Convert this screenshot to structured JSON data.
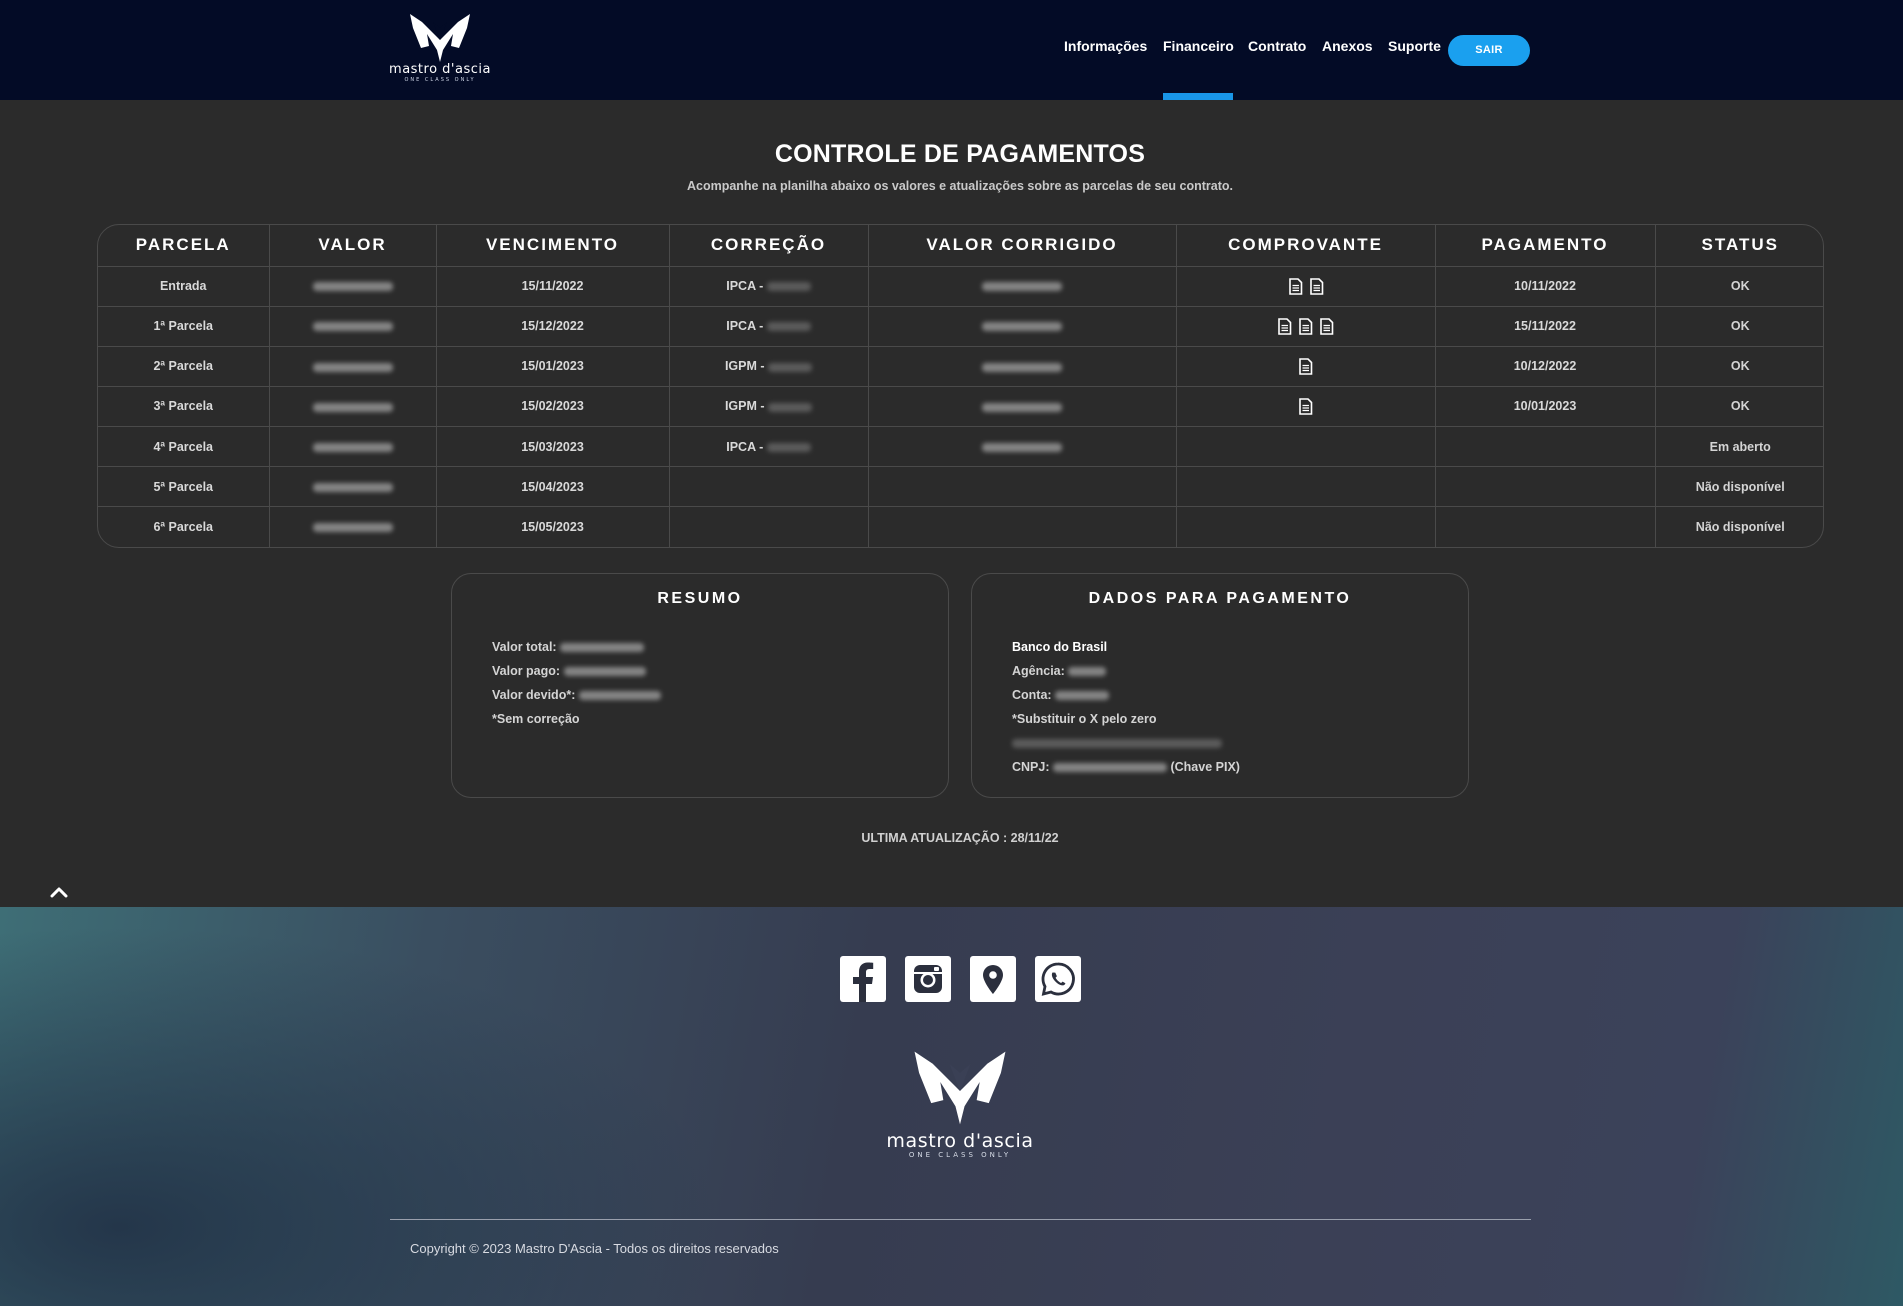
{
  "brand": {
    "name": "mastro d'ascia",
    "tagline": "ONE CLASS ONLY"
  },
  "nav": {
    "items": [
      {
        "label": "Informações"
      },
      {
        "label": "Financeiro",
        "active": true
      },
      {
        "label": "Contrato"
      },
      {
        "label": "Anexos"
      },
      {
        "label": "Suporte"
      }
    ],
    "logout_label": "SAIR"
  },
  "page": {
    "title": "CONTROLE DE PAGAMENTOS",
    "subtitle": "Acompanhe na planilha abaixo os valores e atualizações sobre as parcelas de seu contrato."
  },
  "table": {
    "headers": [
      "PARCELA",
      "VALOR",
      "VENCIMENTO",
      "CORREÇÃO",
      "VALOR CORRIGIDO",
      "COMPROVANTE",
      "PAGAMENTO",
      "STATUS"
    ],
    "rows": [
      {
        "parcela": "Entrada",
        "vencimento": "15/11/2022",
        "correcao": "IPCA -",
        "comprovantes": 2,
        "pagamento": "10/11/2022",
        "status": "OK"
      },
      {
        "parcela": "1ª Parcela",
        "vencimento": "15/12/2022",
        "correcao": "IPCA -",
        "comprovantes": 3,
        "pagamento": "15/11/2022",
        "status": "OK"
      },
      {
        "parcela": "2ª Parcela",
        "vencimento": "15/01/2023",
        "correcao": "IGPM -",
        "comprovantes": 1,
        "pagamento": "10/12/2022",
        "status": "OK"
      },
      {
        "parcela": "3ª Parcela",
        "vencimento": "15/02/2023",
        "correcao": "IGPM -",
        "comprovantes": 1,
        "pagamento": "10/01/2023",
        "status": "OK"
      },
      {
        "parcela": "4ª Parcela",
        "vencimento": "15/03/2023",
        "correcao": "IPCA -",
        "comprovantes": 0,
        "pagamento": "",
        "status": "Em aberto"
      },
      {
        "parcela": "5ª Parcela",
        "vencimento": "15/04/2023",
        "correcao": "",
        "comprovantes": 0,
        "pagamento": "",
        "status": "Não disponível"
      },
      {
        "parcela": "6ª Parcela",
        "vencimento": "15/05/2023",
        "correcao": "",
        "comprovantes": 0,
        "pagamento": "",
        "status": "Não disponível"
      }
    ]
  },
  "resumo": {
    "title": "RESUMO",
    "valor_total_label": "Valor total:",
    "valor_pago_label": "Valor pago:",
    "valor_devido_label": "Valor devido*:",
    "nota": "*Sem correção"
  },
  "dados_pagamento": {
    "title": "DADOS PARA PAGAMENTO",
    "banco": "Banco do Brasil",
    "agencia_label": "Agência:",
    "conta_label": "Conta:",
    "nota": "*Substituir o X pelo zero",
    "cnpj_label": "CNPJ:",
    "pix_label": "(Chave PIX)"
  },
  "last_update": "ULTIMA ATUALIZAÇÃO : 28/11/22",
  "footer": {
    "social_icons": [
      "facebook-icon",
      "instagram-icon",
      "map-pin-icon",
      "whatsapp-icon"
    ],
    "copyright": "Copyright © 2023 Mastro D'Ascia - Todos os direitos reservados"
  },
  "colors": {
    "header_bg": "#030b26",
    "page_bg": "#2b2b2b",
    "accent": "#1aa0ef",
    "border": "#4a4a4a"
  }
}
